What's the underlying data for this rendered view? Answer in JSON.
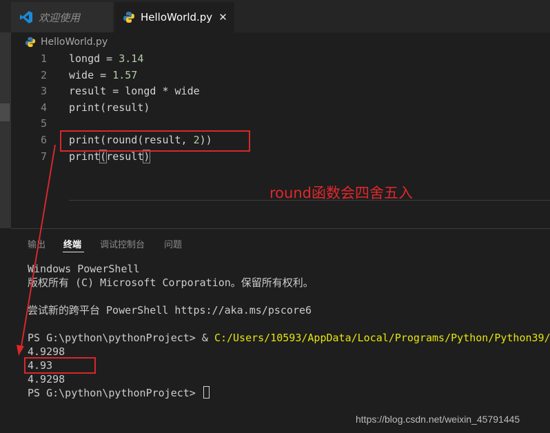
{
  "tabs": [
    {
      "label": "欢迎使用",
      "icon": "vscode-icon",
      "active": false
    },
    {
      "label": "HelloWorld.py",
      "icon": "python-icon",
      "active": true,
      "close": "✕"
    }
  ],
  "breadcrumb": {
    "file": "HelloWorld.py",
    "icon": "python-icon"
  },
  "editor": {
    "line_numbers": [
      "1",
      "2",
      "3",
      "4",
      "5",
      "6",
      "7"
    ],
    "l1": {
      "a": "longd = ",
      "b": "3.14"
    },
    "l2": {
      "a": "wide = ",
      "b": "1.57"
    },
    "l3": "result = longd * wide",
    "l4": "print(result)",
    "l6": {
      "a": "print(round(result, ",
      "b": "2",
      "c": "))"
    },
    "l7": {
      "a": "print",
      "b": "(",
      "c": "result",
      "d": ")"
    }
  },
  "annotation": "round函数会四舍五入",
  "panel": {
    "tabs": [
      "输出",
      "终端",
      "调试控制台",
      "问题"
    ],
    "active_tab": "终端"
  },
  "terminal": {
    "lines": [
      "Windows PowerShell",
      "版权所有 (C) Microsoft Corporation。保留所有权利。",
      "尝试新的跨平台 PowerShell https://aka.ms/pscore6"
    ],
    "prompt": "PS G:\\python\\pythonProject> & ",
    "path": "C:/Users/10593/AppData/Local/Programs/Python/Python39/p",
    "out1": "4.9298",
    "out2": "4.93",
    "out3": "4.9298",
    "prompt2": "PS G:\\python\\pythonProject> "
  },
  "watermark": "https://blog.csdn.net/weixin_45791445",
  "colors": {
    "annotation_red": "#d9272b",
    "terminal_path": "#e5e510",
    "number": "#b5cea8"
  }
}
